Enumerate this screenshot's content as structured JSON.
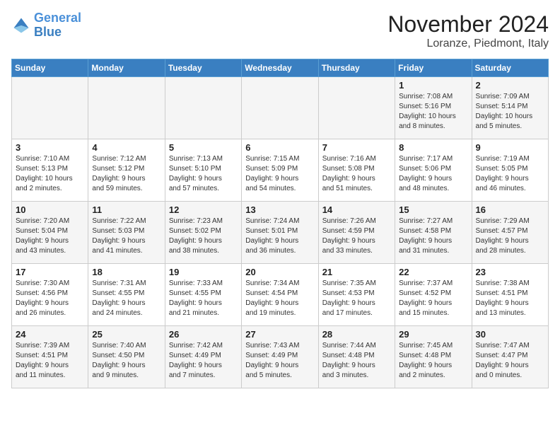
{
  "header": {
    "logo_line1": "General",
    "logo_line2": "Blue",
    "month": "November 2024",
    "location": "Loranze, Piedmont, Italy"
  },
  "weekdays": [
    "Sunday",
    "Monday",
    "Tuesday",
    "Wednesday",
    "Thursday",
    "Friday",
    "Saturday"
  ],
  "weeks": [
    [
      {
        "day": "",
        "info": ""
      },
      {
        "day": "",
        "info": ""
      },
      {
        "day": "",
        "info": ""
      },
      {
        "day": "",
        "info": ""
      },
      {
        "day": "",
        "info": ""
      },
      {
        "day": "1",
        "info": "Sunrise: 7:08 AM\nSunset: 5:16 PM\nDaylight: 10 hours\nand 8 minutes."
      },
      {
        "day": "2",
        "info": "Sunrise: 7:09 AM\nSunset: 5:14 PM\nDaylight: 10 hours\nand 5 minutes."
      }
    ],
    [
      {
        "day": "3",
        "info": "Sunrise: 7:10 AM\nSunset: 5:13 PM\nDaylight: 10 hours\nand 2 minutes."
      },
      {
        "day": "4",
        "info": "Sunrise: 7:12 AM\nSunset: 5:12 PM\nDaylight: 9 hours\nand 59 minutes."
      },
      {
        "day": "5",
        "info": "Sunrise: 7:13 AM\nSunset: 5:10 PM\nDaylight: 9 hours\nand 57 minutes."
      },
      {
        "day": "6",
        "info": "Sunrise: 7:15 AM\nSunset: 5:09 PM\nDaylight: 9 hours\nand 54 minutes."
      },
      {
        "day": "7",
        "info": "Sunrise: 7:16 AM\nSunset: 5:08 PM\nDaylight: 9 hours\nand 51 minutes."
      },
      {
        "day": "8",
        "info": "Sunrise: 7:17 AM\nSunset: 5:06 PM\nDaylight: 9 hours\nand 48 minutes."
      },
      {
        "day": "9",
        "info": "Sunrise: 7:19 AM\nSunset: 5:05 PM\nDaylight: 9 hours\nand 46 minutes."
      }
    ],
    [
      {
        "day": "10",
        "info": "Sunrise: 7:20 AM\nSunset: 5:04 PM\nDaylight: 9 hours\nand 43 minutes."
      },
      {
        "day": "11",
        "info": "Sunrise: 7:22 AM\nSunset: 5:03 PM\nDaylight: 9 hours\nand 41 minutes."
      },
      {
        "day": "12",
        "info": "Sunrise: 7:23 AM\nSunset: 5:02 PM\nDaylight: 9 hours\nand 38 minutes."
      },
      {
        "day": "13",
        "info": "Sunrise: 7:24 AM\nSunset: 5:01 PM\nDaylight: 9 hours\nand 36 minutes."
      },
      {
        "day": "14",
        "info": "Sunrise: 7:26 AM\nSunset: 4:59 PM\nDaylight: 9 hours\nand 33 minutes."
      },
      {
        "day": "15",
        "info": "Sunrise: 7:27 AM\nSunset: 4:58 PM\nDaylight: 9 hours\nand 31 minutes."
      },
      {
        "day": "16",
        "info": "Sunrise: 7:29 AM\nSunset: 4:57 PM\nDaylight: 9 hours\nand 28 minutes."
      }
    ],
    [
      {
        "day": "17",
        "info": "Sunrise: 7:30 AM\nSunset: 4:56 PM\nDaylight: 9 hours\nand 26 minutes."
      },
      {
        "day": "18",
        "info": "Sunrise: 7:31 AM\nSunset: 4:55 PM\nDaylight: 9 hours\nand 24 minutes."
      },
      {
        "day": "19",
        "info": "Sunrise: 7:33 AM\nSunset: 4:55 PM\nDaylight: 9 hours\nand 21 minutes."
      },
      {
        "day": "20",
        "info": "Sunrise: 7:34 AM\nSunset: 4:54 PM\nDaylight: 9 hours\nand 19 minutes."
      },
      {
        "day": "21",
        "info": "Sunrise: 7:35 AM\nSunset: 4:53 PM\nDaylight: 9 hours\nand 17 minutes."
      },
      {
        "day": "22",
        "info": "Sunrise: 7:37 AM\nSunset: 4:52 PM\nDaylight: 9 hours\nand 15 minutes."
      },
      {
        "day": "23",
        "info": "Sunrise: 7:38 AM\nSunset: 4:51 PM\nDaylight: 9 hours\nand 13 minutes."
      }
    ],
    [
      {
        "day": "24",
        "info": "Sunrise: 7:39 AM\nSunset: 4:51 PM\nDaylight: 9 hours\nand 11 minutes."
      },
      {
        "day": "25",
        "info": "Sunrise: 7:40 AM\nSunset: 4:50 PM\nDaylight: 9 hours\nand 9 minutes."
      },
      {
        "day": "26",
        "info": "Sunrise: 7:42 AM\nSunset: 4:49 PM\nDaylight: 9 hours\nand 7 minutes."
      },
      {
        "day": "27",
        "info": "Sunrise: 7:43 AM\nSunset: 4:49 PM\nDaylight: 9 hours\nand 5 minutes."
      },
      {
        "day": "28",
        "info": "Sunrise: 7:44 AM\nSunset: 4:48 PM\nDaylight: 9 hours\nand 3 minutes."
      },
      {
        "day": "29",
        "info": "Sunrise: 7:45 AM\nSunset: 4:48 PM\nDaylight: 9 hours\nand 2 minutes."
      },
      {
        "day": "30",
        "info": "Sunrise: 7:47 AM\nSunset: 4:47 PM\nDaylight: 9 hours\nand 0 minutes."
      }
    ]
  ]
}
